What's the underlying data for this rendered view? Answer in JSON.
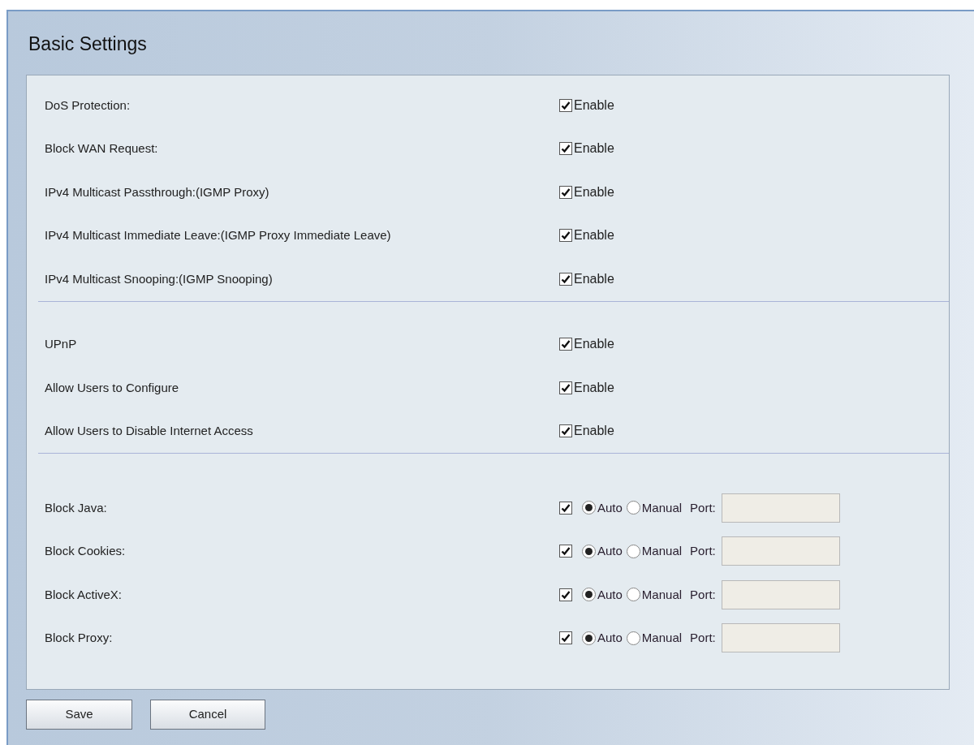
{
  "title": "Basic Settings",
  "sections": [
    {
      "rows": [
        {
          "kind": "enable",
          "label": "DoS Protection:",
          "checked": true,
          "option": "Enable"
        },
        {
          "kind": "enable",
          "label": "Block WAN Request:",
          "checked": true,
          "option": "Enable"
        },
        {
          "kind": "enable",
          "label": "IPv4 Multicast Passthrough:(IGMP Proxy)",
          "checked": true,
          "option": "Enable"
        },
        {
          "kind": "enable",
          "label": "IPv4 Multicast Immediate Leave:(IGMP Proxy Immediate Leave)",
          "checked": true,
          "option": "Enable"
        },
        {
          "kind": "enable",
          "label": "IPv4 Multicast Snooping:(IGMP Snooping)",
          "checked": true,
          "option": "Enable"
        }
      ]
    },
    {
      "rows": [
        {
          "kind": "enable",
          "label": "UPnP",
          "checked": true,
          "option": "Enable"
        },
        {
          "kind": "enable",
          "label": "Allow Users to Configure",
          "checked": true,
          "option": "Enable"
        },
        {
          "kind": "enable",
          "label": "Allow Users to Disable Internet Access",
          "checked": true,
          "option": "Enable"
        }
      ]
    },
    {
      "rows": [
        {
          "kind": "block",
          "label": "Block Java:",
          "checked": true,
          "radios": [
            {
              "label": "Auto",
              "selected": true
            },
            {
              "label": "Manual",
              "selected": false
            }
          ],
          "port_label": "Port:",
          "port_disabled": true
        },
        {
          "kind": "block",
          "label": "Block Cookies:",
          "checked": true,
          "radios": [
            {
              "label": "Auto",
              "selected": true
            },
            {
              "label": "Manual",
              "selected": false
            }
          ],
          "port_label": "Port:",
          "port_disabled": true
        },
        {
          "kind": "block",
          "label": "Block ActiveX:",
          "checked": true,
          "radios": [
            {
              "label": "Auto",
              "selected": true
            },
            {
              "label": "Manual",
              "selected": false
            }
          ],
          "port_label": "Port:",
          "port_disabled": true
        },
        {
          "kind": "block",
          "label": "Block Proxy:",
          "checked": true,
          "radios": [
            {
              "label": "Auto",
              "selected": true
            },
            {
              "label": "Manual",
              "selected": false
            }
          ],
          "port_label": "Port:",
          "port_disabled": true
        }
      ]
    }
  ],
  "buttons": [
    "Save",
    "Cancel"
  ]
}
